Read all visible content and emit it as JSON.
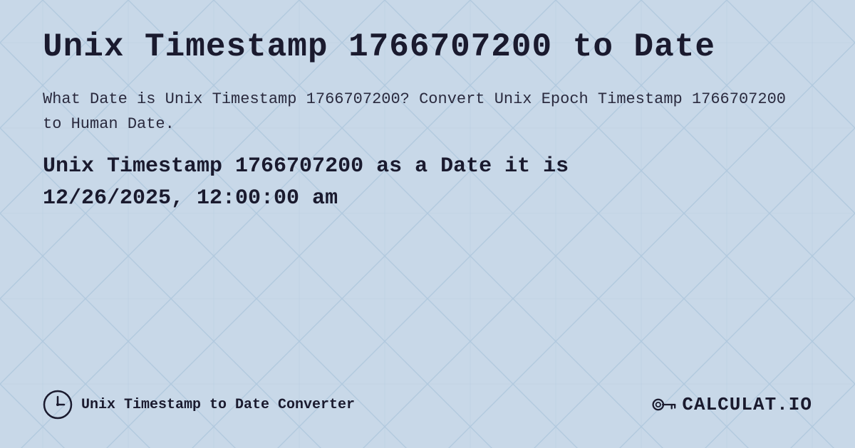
{
  "page": {
    "title": "Unix Timestamp 1766707200 to Date",
    "description": "What Date is Unix Timestamp 1766707200? Convert Unix Epoch Timestamp 1766707200 to Human Date.",
    "result_line1": "Unix Timestamp 1766707200 as a Date it is",
    "result_line2": "12/26/2025, 12:00:00 am",
    "footer": {
      "link_text": "Unix Timestamp to Date Converter",
      "logo_text": "CALCULAT.IO"
    },
    "background": {
      "color": "#c8d8e8",
      "pattern_color": "#aac4dc"
    }
  }
}
